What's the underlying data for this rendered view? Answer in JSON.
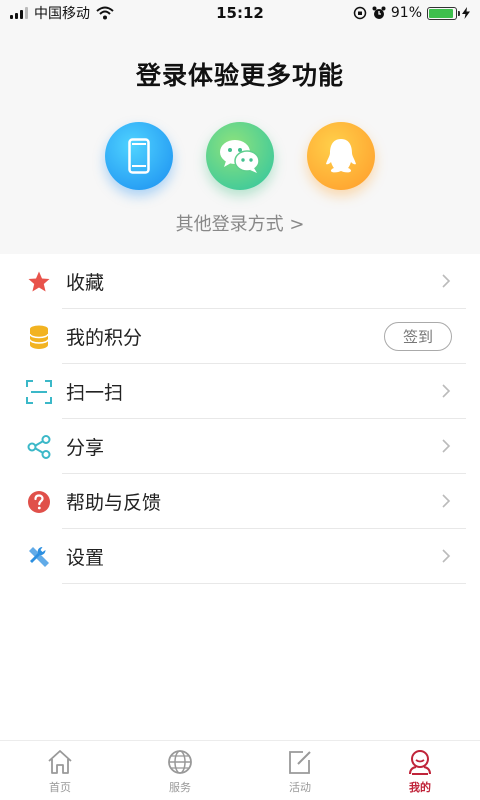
{
  "status_bar": {
    "carrier": "中国移动",
    "time": "15:12",
    "battery_percent": "91%",
    "battery_level": 0.91
  },
  "login": {
    "title": "登录体验更多功能",
    "other_login": "其他登录方式 >",
    "methods": [
      "phone-icon",
      "wechat-icon",
      "qq-icon"
    ]
  },
  "menu": {
    "items": [
      {
        "label": "收藏",
        "icon": "star-icon",
        "color": "#e8534b"
      },
      {
        "label": "我的积分",
        "icon": "coins-icon",
        "color": "#f2b321",
        "action": "签到"
      },
      {
        "label": "扫一扫",
        "icon": "scan-icon",
        "color": "#3bb8c8"
      },
      {
        "label": "分享",
        "icon": "share-icon",
        "color": "#3bb8c8"
      },
      {
        "label": "帮助与反馈",
        "icon": "help-icon",
        "color": "#e0504a"
      },
      {
        "label": "设置",
        "icon": "settings-icon",
        "color": "#2c8fe0"
      }
    ]
  },
  "tab_bar": {
    "tabs": [
      {
        "label": "首页",
        "icon": "home-icon"
      },
      {
        "label": "服务",
        "icon": "globe-icon"
      },
      {
        "label": "活动",
        "icon": "edit-icon"
      },
      {
        "label": "我的",
        "icon": "profile-icon",
        "active": true
      }
    ],
    "active_color": "#c0243a"
  }
}
